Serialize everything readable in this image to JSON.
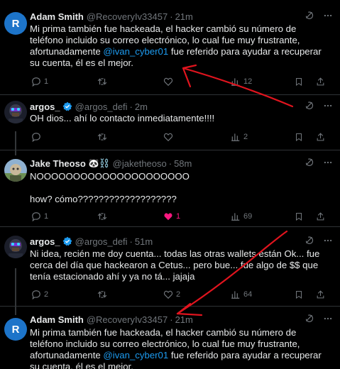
{
  "tweets": [
    {
      "name": "Adam Smith",
      "handle": "@RecoveryIv33457",
      "time": "21m",
      "avatar_letter": "R",
      "text_before": "Mi prima también fue hackeada, el hacker cambió su número de teléfono incluido su correo electrónico, lo cual fue muy frustrante, afortunadamente ",
      "mention": "@ivan_cyber01",
      "text_after": " fue referido para ayudar a recuperar su cuenta, él es el mejor.",
      "replies": "1",
      "retweets": "",
      "likes": "",
      "views": "12"
    },
    {
      "name": "argos_",
      "handle": "@argos_defi",
      "time": "2m",
      "text": "OH dios... ahí lo contacto inmediatamente!!!!",
      "replies": "",
      "retweets": "",
      "likes": "",
      "views": "2"
    },
    {
      "name": "Jake Theoso",
      "name_emojis": "🐼⛓️",
      "handle": "@jaketheoso",
      "time": "58m",
      "text_line1": "NOOOOOOOOOOOOOOOOOOOOO",
      "text_line2": "how? cómo???????????????????",
      "replies": "1",
      "retweets": "",
      "likes": "1",
      "views": "69"
    },
    {
      "name": "argos_",
      "handle": "@argos_defi",
      "time": "51m",
      "text": "Ni idea, recién me doy cuenta... todas las otras wallets están Ok... fue cerca del día que hackearon a Cetus... pero bue... fue algo de $$ que tenía estacionado ahí y ya no tá... jajaja",
      "replies": "2",
      "retweets": "",
      "likes": "2",
      "views": "64"
    },
    {
      "name": "Adam Smith",
      "handle": "@RecoveryIv33457",
      "time": "21m",
      "avatar_letter": "R",
      "text_before": "Mi prima también fue hackeada, el hacker cambió su número de teléfono incluido su correo electrónico, lo cual fue muy frustrante, afortunadamente ",
      "mention": "@ivan_cyber01",
      "text_after": " fue referido para ayudar a recuperar su cuenta, él es el mejor."
    }
  ],
  "colors": {
    "background": "#000000",
    "text": "#e7e9ea",
    "muted": "#71767b",
    "accent": "#1d9bf0",
    "like": "#f91880",
    "annotation": "#e0141e"
  },
  "icons": [
    "reply-icon",
    "retweet-icon",
    "like-icon",
    "views-icon",
    "grok-icon",
    "more-icon",
    "verified-icon"
  ]
}
